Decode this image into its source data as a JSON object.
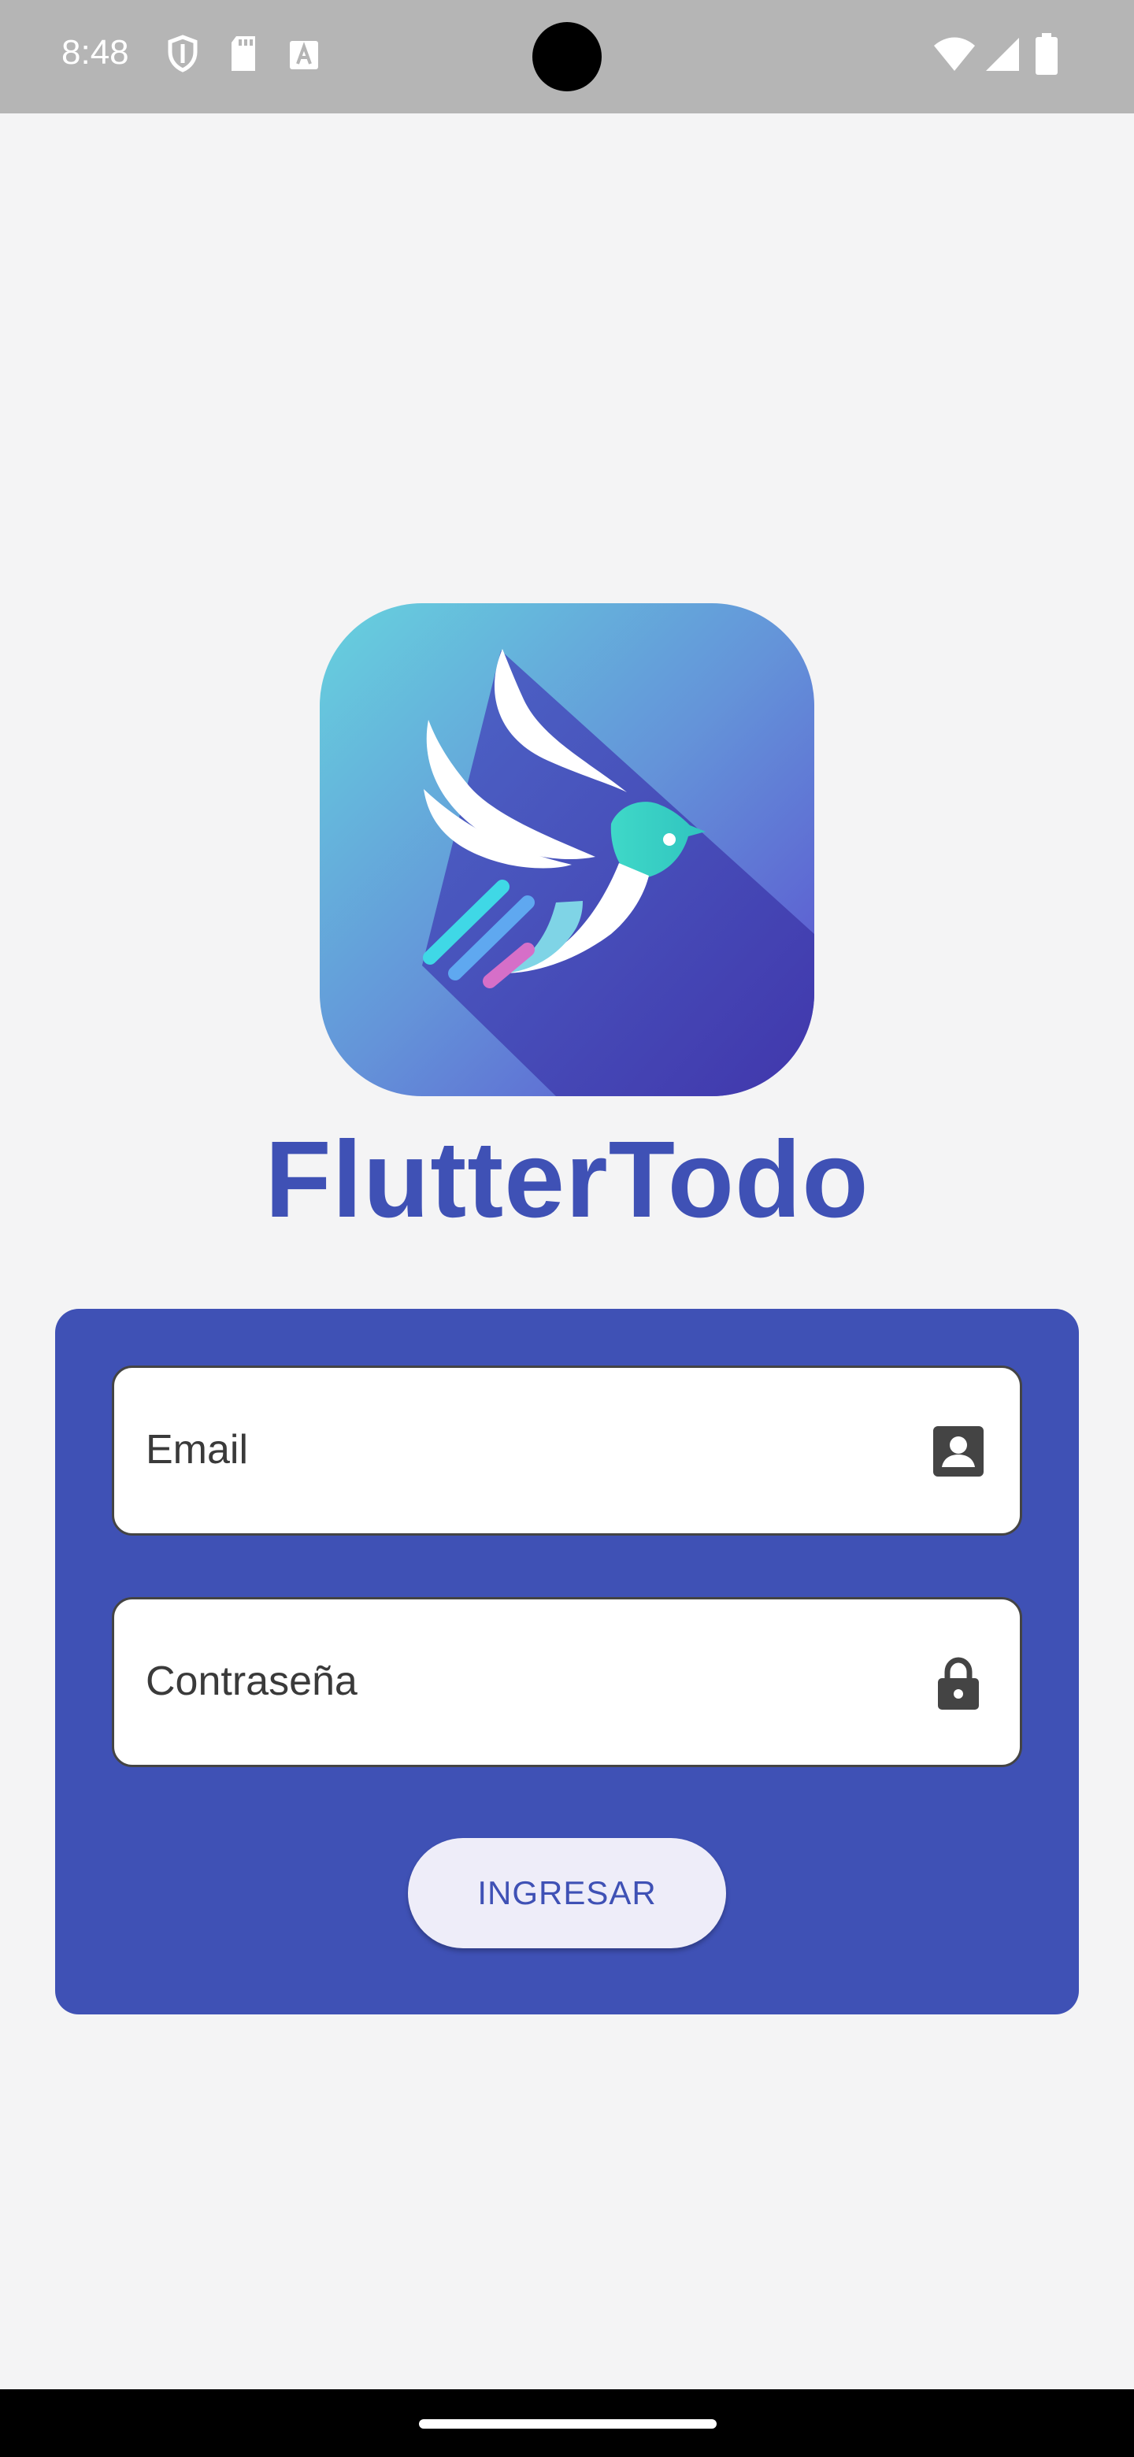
{
  "status_bar": {
    "time": "8:48",
    "left_icons": [
      "shield-icon",
      "sd-card-icon",
      "a-notification-icon"
    ],
    "right_icons": [
      "wifi-icon",
      "signal-icon",
      "battery-icon"
    ]
  },
  "app": {
    "logo_icon": "bird-logo-icon",
    "name": "FlutterTodo"
  },
  "login_form": {
    "email_placeholder": "Email",
    "email_icon": "contact-card-icon",
    "password_placeholder": "Contraseña",
    "password_icon": "lock-icon",
    "submit_label": "INGRESAR"
  },
  "colors": {
    "primary": "#3f51b5",
    "background": "#f4f4f5",
    "button_bg": "#eeedf9"
  }
}
